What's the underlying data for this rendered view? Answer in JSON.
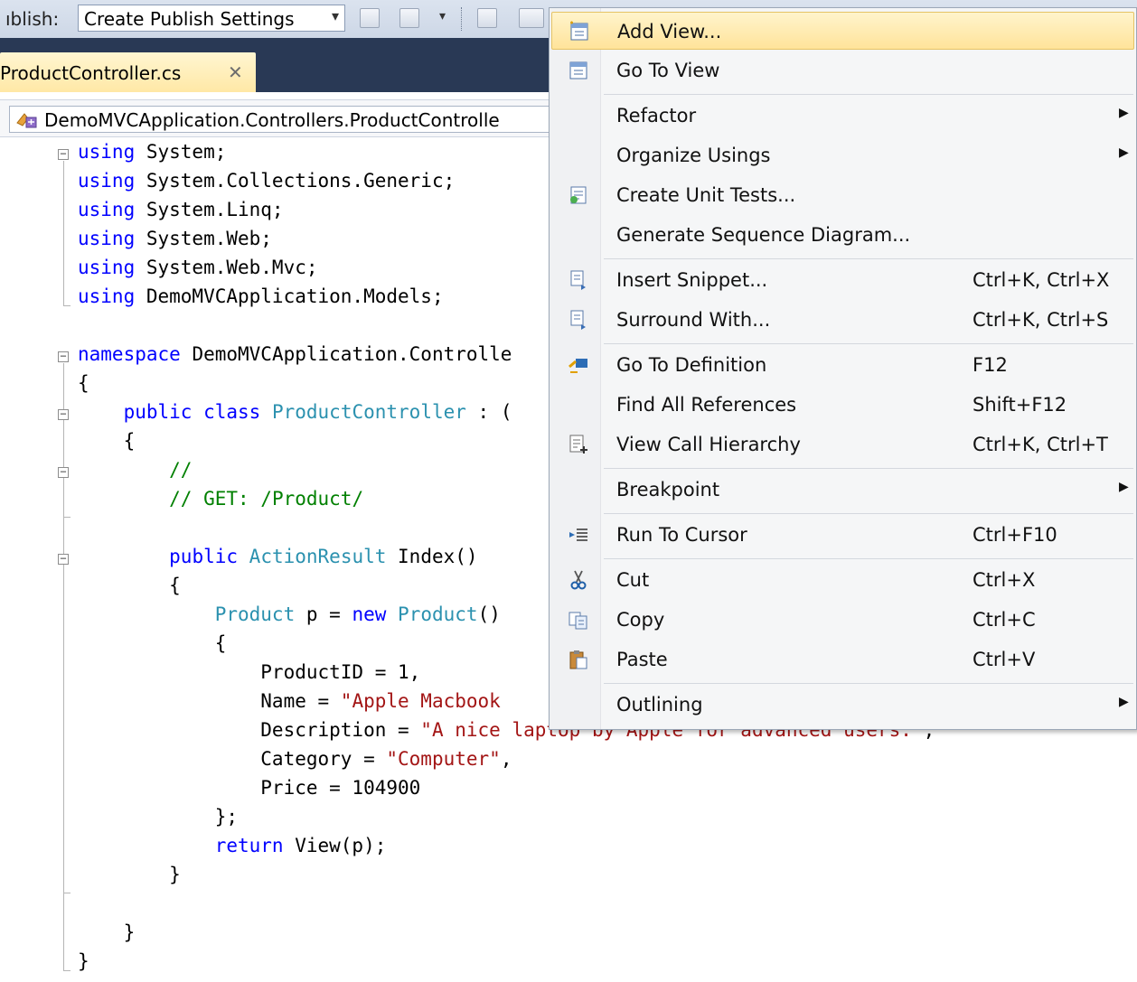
{
  "toolbar": {
    "publish_label": "ıblish:",
    "publish_select": "Create Publish Settings"
  },
  "tab": {
    "label": "ProductController.cs",
    "close_glyph": "✕"
  },
  "navigation": {
    "class_combo": "DemoMVCApplication.Controllers.ProductControlle"
  },
  "editor": {
    "lines": [
      "using System;",
      "using System.Collections.Generic;",
      "using System.Linq;",
      "using System.Web;",
      "using System.Web.Mvc;",
      "using DemoMVCApplication.Models;",
      "",
      "namespace DemoMVCApplication.Controlle",
      "{",
      "    public class ProductController : (",
      "    {",
      "        //",
      "        // GET: /Product/",
      "",
      "        public ActionResult Index()",
      "        {",
      "            Product p = new Product()",
      "            {",
      "                ProductID = 1,",
      "                Name = \"Apple Macbook",
      "                Description = \"A nice laptop by Apple for advanced users.\",",
      "                Category = \"Computer\",",
      "                Price = 104900",
      "            };",
      "            return View(p);",
      "        }",
      "",
      "    }",
      "}"
    ]
  },
  "context_menu": {
    "items": [
      {
        "label": "Add View...",
        "shortcut": "",
        "icon": "add-view-icon",
        "submenu": false,
        "highlighted": true
      },
      {
        "label": "Go To View",
        "shortcut": "",
        "icon": "go-to-view-icon",
        "submenu": false,
        "highlighted": false
      },
      {
        "label": "Refactor",
        "shortcut": "",
        "icon": "",
        "submenu": true,
        "highlighted": false
      },
      {
        "label": "Organize Usings",
        "shortcut": "",
        "icon": "",
        "submenu": true,
        "highlighted": false
      },
      {
        "label": "Create Unit Tests...",
        "shortcut": "",
        "icon": "unit-test-icon",
        "submenu": false,
        "highlighted": false
      },
      {
        "label": "Generate Sequence Diagram...",
        "shortcut": "",
        "icon": "",
        "submenu": false,
        "highlighted": false
      },
      {
        "label": "Insert Snippet...",
        "shortcut": "Ctrl+K, Ctrl+X",
        "icon": "insert-snippet-icon",
        "submenu": false,
        "highlighted": false
      },
      {
        "label": "Surround With...",
        "shortcut": "Ctrl+K, Ctrl+S",
        "icon": "surround-with-icon",
        "submenu": false,
        "highlighted": false
      },
      {
        "label": "Go To Definition",
        "shortcut": "F12",
        "icon": "go-to-definition-icon",
        "submenu": false,
        "highlighted": false
      },
      {
        "label": "Find All References",
        "shortcut": "Shift+F12",
        "icon": "",
        "submenu": false,
        "highlighted": false
      },
      {
        "label": "View Call Hierarchy",
        "shortcut": "Ctrl+K, Ctrl+T",
        "icon": "call-hierarchy-icon",
        "submenu": false,
        "highlighted": false
      },
      {
        "label": "Breakpoint",
        "shortcut": "",
        "icon": "",
        "submenu": true,
        "highlighted": false
      },
      {
        "label": "Run To Cursor",
        "shortcut": "Ctrl+F10",
        "icon": "run-to-cursor-icon",
        "submenu": false,
        "highlighted": false
      },
      {
        "label": "Cut",
        "shortcut": "Ctrl+X",
        "icon": "scissors-icon",
        "submenu": false,
        "highlighted": false
      },
      {
        "label": "Copy",
        "shortcut": "Ctrl+C",
        "icon": "copy-icon",
        "submenu": false,
        "highlighted": false
      },
      {
        "label": "Paste",
        "shortcut": "Ctrl+V",
        "icon": "paste-icon",
        "submenu": false,
        "highlighted": false
      },
      {
        "label": "Outlining",
        "shortcut": "",
        "icon": "",
        "submenu": true,
        "highlighted": false
      }
    ]
  },
  "colors": {
    "keyword": "#0000ff",
    "type": "#2b91af",
    "string": "#a31515",
    "comment": "#008000",
    "tab_strip": "#293955",
    "menu_highlight": "#ffe39a"
  }
}
